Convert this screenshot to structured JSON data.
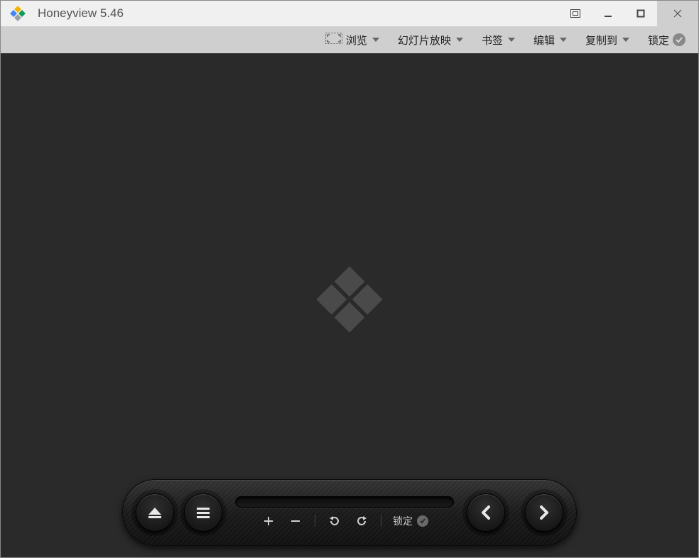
{
  "titlebar": {
    "title": "Honeyview 5.46"
  },
  "toolbar": {
    "browse_label": "浏览",
    "slideshow_label": "幻灯片放映",
    "bookmark_label": "书签",
    "edit_label": "编辑",
    "copyto_label": "复制到",
    "lock_label": "锁定"
  },
  "controls": {
    "lock_label": "锁定"
  }
}
